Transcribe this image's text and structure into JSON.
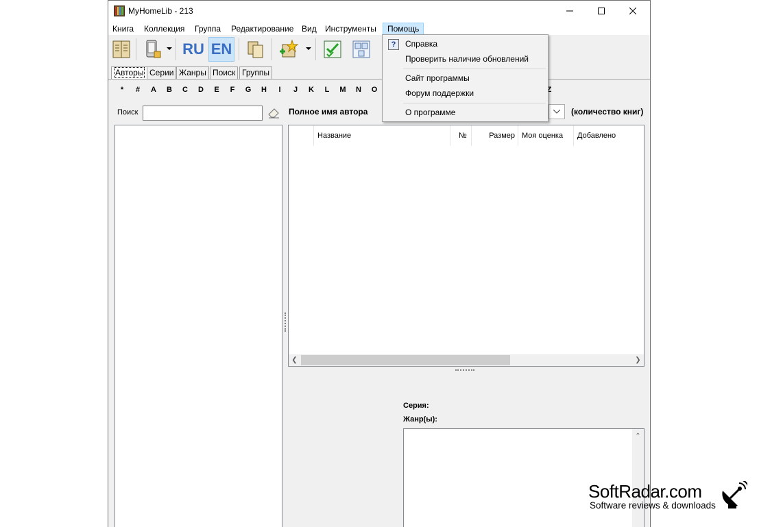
{
  "window": {
    "title": "MyHomeLib - 213"
  },
  "menu": [
    "Книга",
    "Коллекция",
    "Группа",
    "Редактирование",
    "Вид",
    "Инструменты",
    "Помощь"
  ],
  "toolbar": {
    "lang_ru": "RU",
    "lang_en": "EN"
  },
  "tabs": [
    "Авторы",
    "Серии",
    "Жанры",
    "Поиск",
    "Группы"
  ],
  "alphabet": [
    "*",
    "#",
    "A",
    "B",
    "C",
    "D",
    "E",
    "F",
    "G",
    "H",
    "I",
    "J",
    "K",
    "L",
    "M",
    "N",
    "O"
  ],
  "alphabet_extra": "Z",
  "search": {
    "label": "Поиск",
    "value": ""
  },
  "author": {
    "label": "Полное имя автора",
    "count_label": "(количество книг)"
  },
  "grid": {
    "columns": [
      "Название",
      "№",
      "Размер",
      "Моя оценка",
      "Добавлено"
    ]
  },
  "details": {
    "series_label": "Серия:",
    "genre_label": "Жанр(ы):"
  },
  "help_menu": {
    "items": [
      "Справка",
      "Проверить наличие обновлений",
      "Сайт программы",
      "Форум поддержки",
      "О программе"
    ]
  },
  "watermark": {
    "name": "SoftRadar.com",
    "tagline": "Software reviews & downloads"
  },
  "colors": {
    "menu_highlight": "#cce8ff",
    "toolbar_pressed": "#cce4f7"
  },
  "icons": [
    "app-books-icon",
    "book-open-icon",
    "device-icon",
    "copy-icon",
    "add-star-icon",
    "checklist-icon",
    "layout-icon",
    "help-icon",
    "eraser-icon",
    "satellite-icon"
  ]
}
